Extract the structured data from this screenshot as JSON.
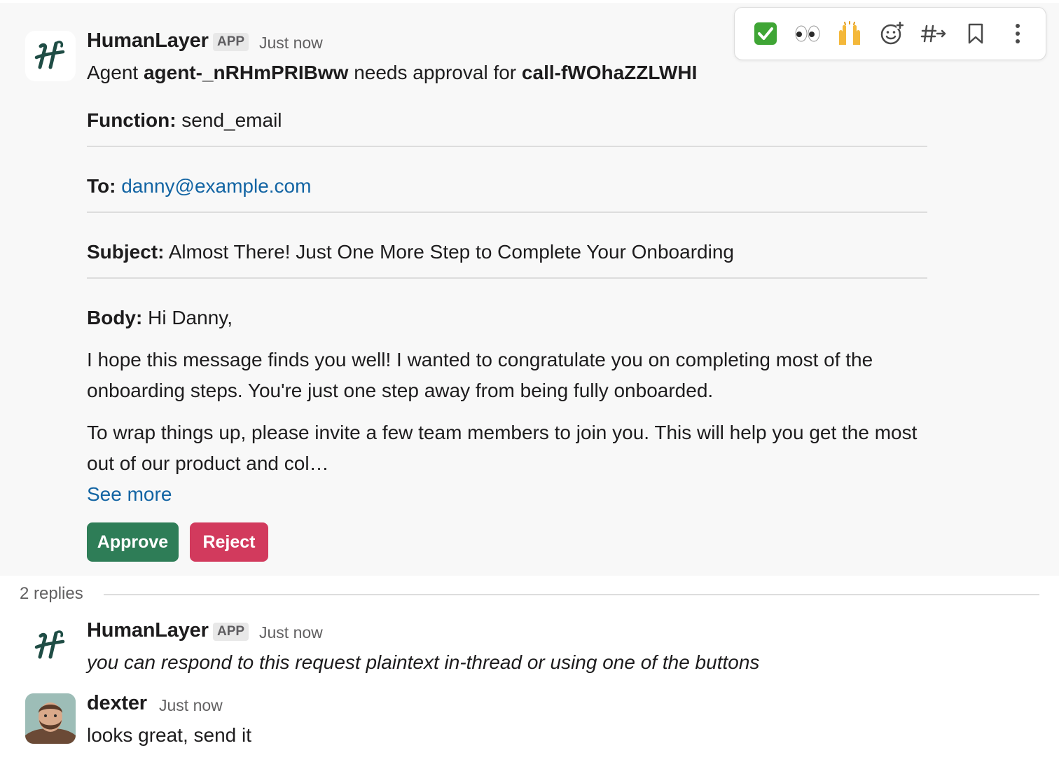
{
  "toolbar": {
    "items": [
      {
        "name": "check-mark-reaction",
        "glyph": "✅"
      },
      {
        "name": "eyes-reaction",
        "glyph": "👀"
      },
      {
        "name": "raised-hands-reaction",
        "glyph": "🙌"
      },
      {
        "name": "add-reaction",
        "icon": "emoji-add-icon"
      },
      {
        "name": "reply-in-channel",
        "icon": "hash-arrow-icon"
      },
      {
        "name": "save-message",
        "icon": "bookmark-icon"
      },
      {
        "name": "more-actions",
        "icon": "kebab-icon"
      }
    ]
  },
  "main_message": {
    "author": "HumanLayer",
    "badge": "APP",
    "timestamp": "Just now",
    "intro_prefix": "Agent ",
    "agent_id": "agent-_nRHmPRIBww",
    "intro_middle": " needs approval for ",
    "call_id": "call-fWOhaZZLWHI",
    "function_label": "Function:",
    "function_value": " send_email",
    "to_label": "To:",
    "to_value": "danny@example.com",
    "subject_label": "Subject:",
    "subject_value": " Almost There! Just One More Step to Complete Your Onboarding",
    "body_label": "Body:",
    "body_greeting": " Hi Danny,",
    "body_paragraph_1": "I hope this message finds you well! I wanted to congratulate you on completing most of the onboarding steps. You're just one step away from being fully onboarded.",
    "body_paragraph_2": "To wrap things up, please invite a few team members to join you. This will help you get the most out of our product and col…",
    "see_more": "See more",
    "approve_label": "Approve",
    "reject_label": "Reject"
  },
  "thread": {
    "replies_count": "2 replies",
    "replies": [
      {
        "author": "HumanLayer",
        "badge": "APP",
        "timestamp": "Just now",
        "text": "you can respond to this request plaintext in-thread or using one of the buttons"
      },
      {
        "author": "dexter",
        "timestamp": "Just now",
        "text": "looks great, send it"
      }
    ]
  },
  "colors": {
    "approve": "#2e7d57",
    "reject": "#d23a5d",
    "link": "#1264a3",
    "brand_logo": "#1f4d45"
  }
}
